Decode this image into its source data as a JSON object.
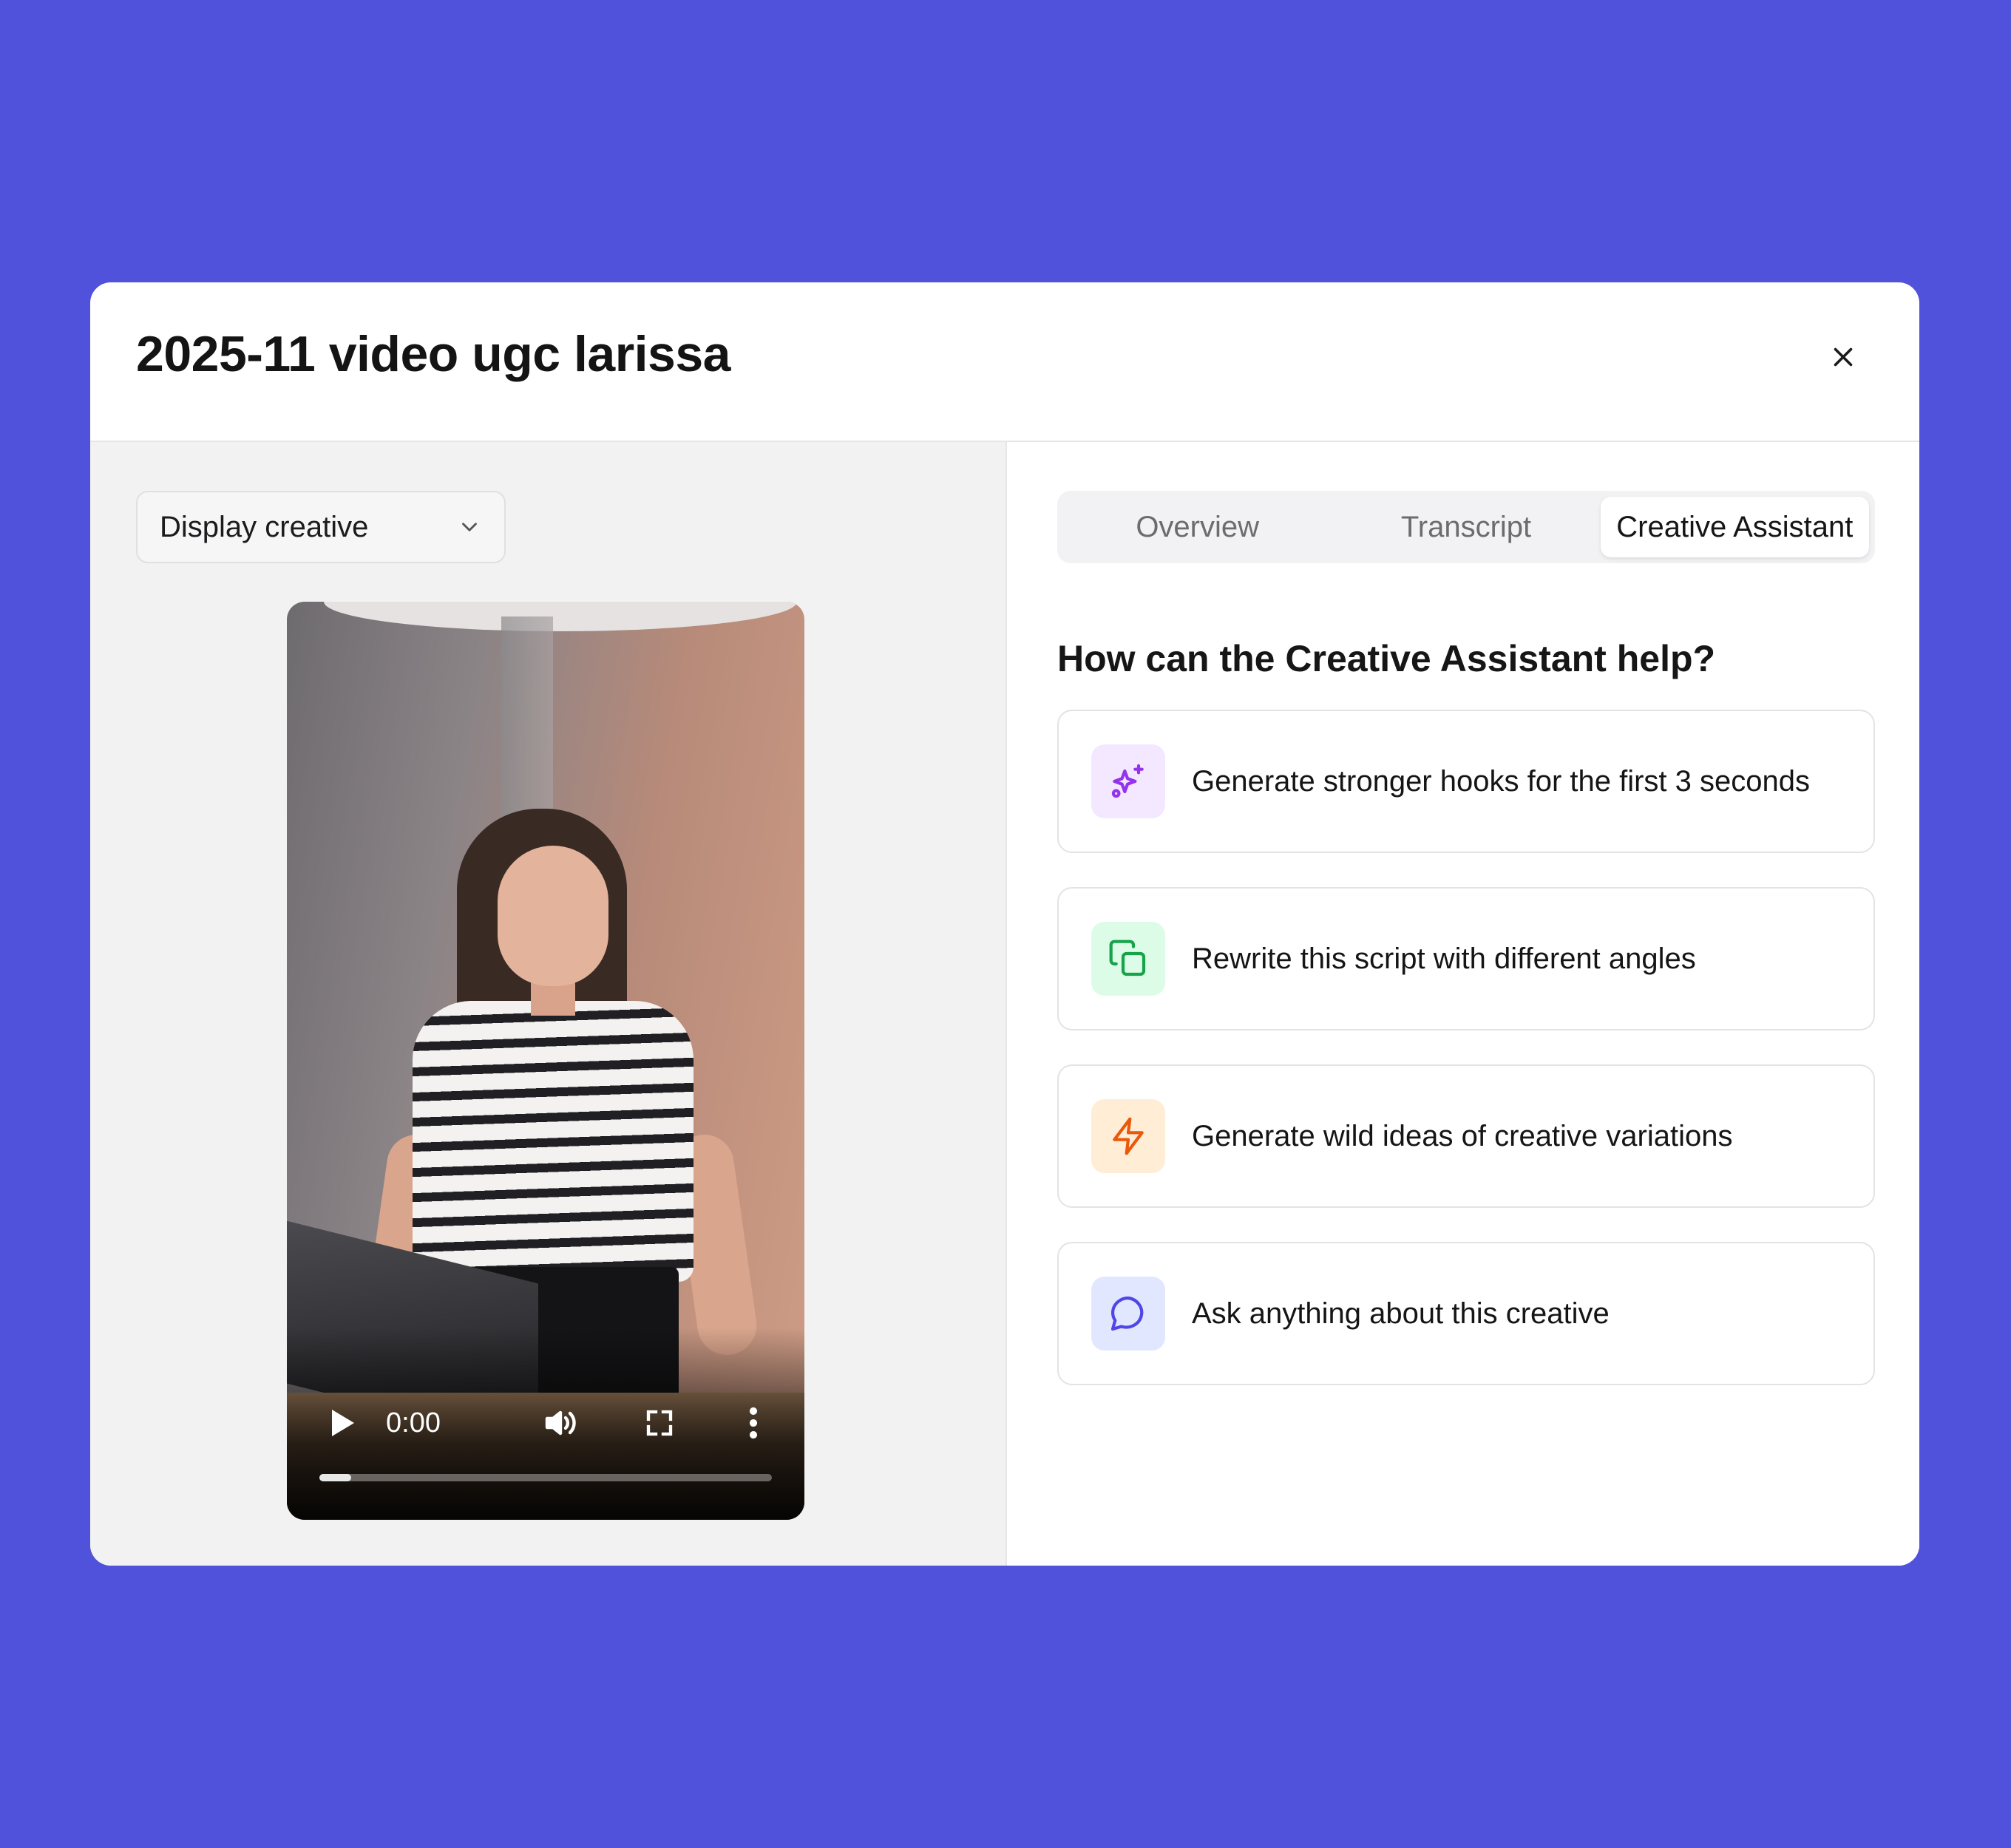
{
  "modal": {
    "title": "2025-11 video ugc larissa",
    "close_icon": "close-icon"
  },
  "left_panel": {
    "display_select": {
      "value": "Display creative",
      "icon": "chevron-down-icon"
    },
    "video_player": {
      "time": "0:00",
      "progress": 0.07,
      "controls": [
        "play-icon",
        "volume-icon",
        "fullscreen-icon",
        "more-options-icon"
      ]
    }
  },
  "right_panel": {
    "tabs": [
      {
        "label": "Overview",
        "active": false
      },
      {
        "label": "Transcript",
        "active": false
      },
      {
        "label": "Creative Assistant",
        "active": true
      }
    ],
    "heading": "How can the Creative Assistant help?",
    "suggestions": [
      {
        "label": "Generate stronger hooks for the first 3 seconds",
        "icon": "sparkles-icon",
        "icon_color": "#9333EA",
        "icon_bg": "#F3E8FF"
      },
      {
        "label": "Rewrite this script with different angles",
        "icon": "copy-icon",
        "icon_color": "#16A34A",
        "icon_bg": "#DCFCE7"
      },
      {
        "label": "Generate wild ideas of creative variations",
        "icon": "lightning-icon",
        "icon_color": "#EA580C",
        "icon_bg": "#FFEDD5"
      },
      {
        "label": "Ask anything about this creative",
        "icon": "chat-bubble-icon",
        "icon_color": "#4F46E5",
        "icon_bg": "#E0E7FF"
      }
    ]
  },
  "colors": {
    "background": "#5152DC",
    "modal_bg": "#FFFFFF",
    "left_pane_bg": "#F2F2F2"
  }
}
